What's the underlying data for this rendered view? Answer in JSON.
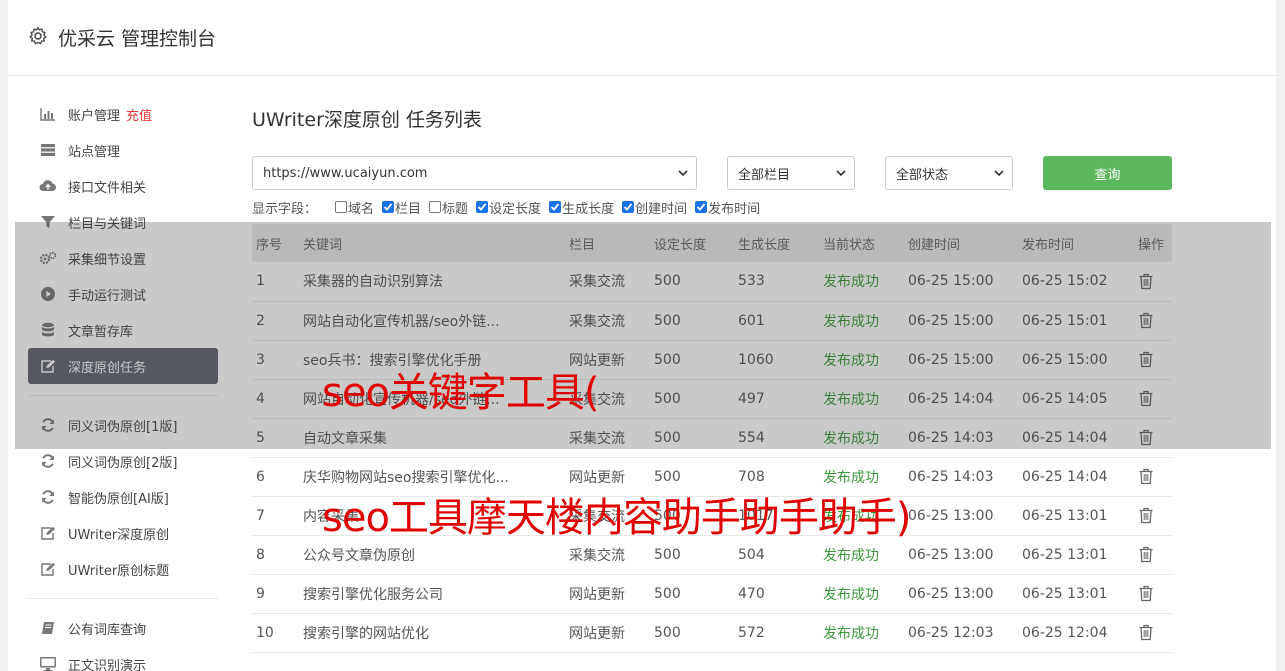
{
  "header": {
    "title": "优采云 管理控制台"
  },
  "sidebar": {
    "groups": [
      [
        {
          "label": "账户管理",
          "extra": "充值",
          "icon": "bar-chart-icon"
        },
        {
          "label": "站点管理",
          "icon": "server-icon"
        },
        {
          "label": "接口文件相关",
          "icon": "cloud-upload-icon"
        },
        {
          "label": "栏目与关键词",
          "icon": "filter-icon"
        },
        {
          "label": "采集细节设置",
          "icon": "gears-icon"
        },
        {
          "label": "手动运行测试",
          "icon": "play-icon"
        },
        {
          "label": "文章暂存库",
          "icon": "database-icon"
        },
        {
          "label": "深度原创任务",
          "icon": "edit-icon",
          "active": true
        }
      ],
      [
        {
          "label": "同义词伪原创[1版]",
          "icon": "refresh-icon"
        },
        {
          "label": "同义词伪原创[2版]",
          "icon": "refresh-icon"
        },
        {
          "label": "智能伪原创[AI版]",
          "icon": "refresh-icon"
        },
        {
          "label": "UWriter深度原创",
          "icon": "edit-icon"
        },
        {
          "label": "UWriter原创标题",
          "icon": "edit-icon"
        }
      ],
      [
        {
          "label": "公有词库查询",
          "icon": "book-icon"
        },
        {
          "label": "正文识别演示",
          "icon": "monitor-icon"
        }
      ]
    ]
  },
  "main": {
    "title": "UWriter深度原创 任务列表",
    "site_select": "https://www.ucaiyun.com",
    "column_select": "全部栏目",
    "status_select": "全部状态",
    "query_label": "查询",
    "fields_label": "显示字段：",
    "fields": [
      {
        "label": "域名",
        "checked": false
      },
      {
        "label": "栏目",
        "checked": true
      },
      {
        "label": "标题",
        "checked": false
      },
      {
        "label": "设定长度",
        "checked": true
      },
      {
        "label": "生成长度",
        "checked": true
      },
      {
        "label": "创建时间",
        "checked": true
      },
      {
        "label": "发布时间",
        "checked": true
      }
    ],
    "columns": [
      "序号",
      "关键词",
      "栏目",
      "设定长度",
      "生成长度",
      "当前状态",
      "创建时间",
      "发布时间",
      "操作"
    ],
    "rows": [
      [
        "1",
        "采集器的自动识别算法",
        "采集交流",
        "500",
        "533",
        "发布成功",
        "06-25 15:00",
        "06-25 15:02"
      ],
      [
        "2",
        "网站自动化宣传机器/seo外链...",
        "采集交流",
        "500",
        "601",
        "发布成功",
        "06-25 15:00",
        "06-25 15:01"
      ],
      [
        "3",
        "seo兵书：搜索引擎优化手册",
        "网站更新",
        "500",
        "1060",
        "发布成功",
        "06-25 15:00",
        "06-25 15:00"
      ],
      [
        "4",
        "网站自动化宣传机器/seo外链...",
        "采集交流",
        "500",
        "497",
        "发布成功",
        "06-25 14:04",
        "06-25 14:05"
      ],
      [
        "5",
        "自动文章采集",
        "采集交流",
        "500",
        "554",
        "发布成功",
        "06-25 14:03",
        "06-25 14:04"
      ],
      [
        "6",
        "庆华购物网站seo搜索引擎优化...",
        "网站更新",
        "500",
        "708",
        "发布成功",
        "06-25 14:03",
        "06-25 14:04"
      ],
      [
        "7",
        "内容采集",
        "采集交流",
        "500",
        "1017",
        "发布成功",
        "06-25 13:00",
        "06-25 13:01"
      ],
      [
        "8",
        "公众号文章伪原创",
        "采集交流",
        "500",
        "504",
        "发布成功",
        "06-25 13:00",
        "06-25 13:01"
      ],
      [
        "9",
        "搜索引擎优化服务公司",
        "网站更新",
        "500",
        "470",
        "发布成功",
        "06-25 13:00",
        "06-25 13:01"
      ],
      [
        "10",
        "搜索引擎的网站优化",
        "网站更新",
        "500",
        "572",
        "发布成功",
        "06-25 12:03",
        "06-25 12:04"
      ]
    ]
  },
  "watermark": {
    "line1": "seo关键字工具(",
    "line2": "seo工具摩天楼内容助手助手助手)"
  },
  "colors": {
    "accent_green": "#5cb85c",
    "status_green": "#3a9a3a",
    "active_bg": "#5f6270",
    "watermark_red": "#e00000"
  }
}
